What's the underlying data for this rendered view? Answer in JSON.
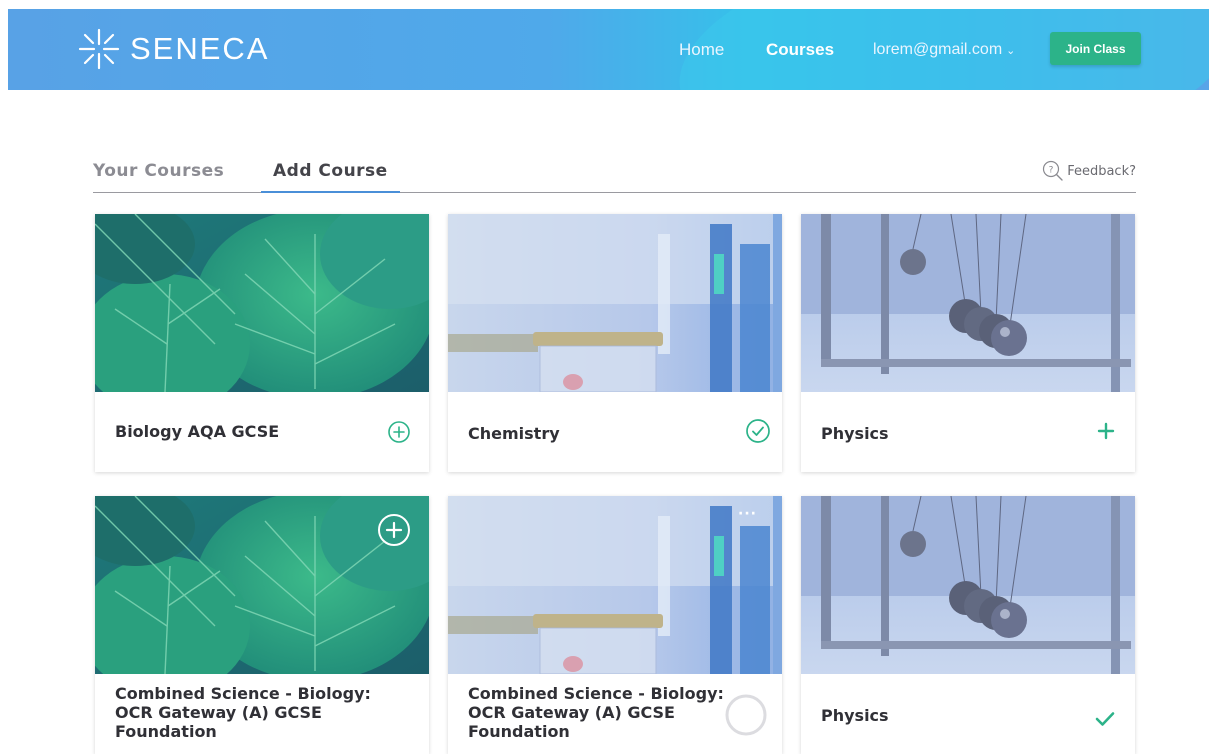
{
  "app": {
    "logo_text": "SENECA",
    "colors": {
      "accent": "#2cb389",
      "header": "#4fa9ea",
      "tab_underline": "#4a8fd8"
    }
  },
  "nav": {
    "home": "Home",
    "courses": "Courses",
    "account": "lorem@gmail.com",
    "account_chevron": "⌄",
    "join_class": "Join Class"
  },
  "tabs": {
    "your_courses": "Your Courses",
    "add_course": "Add Course",
    "feedback": "Feedback?"
  },
  "courses": [
    {
      "title": "Biology AQA GCSE",
      "image": "leaves-image",
      "status": "add-circle-icon"
    },
    {
      "title": "Chemistry",
      "image": "lab-jar-image",
      "status": "check-circle-icon"
    },
    {
      "title": "Physics",
      "image": "newtons-cradle-image",
      "status": "plus-icon"
    },
    {
      "title": "Combined Science - Biology: OCR Gateway (A) GCSE Foundation",
      "image": "leaves-image",
      "status": "add-circle-icon"
    },
    {
      "title": "Combined Science - Biology: OCR Gateway (A) GCSE Foundation",
      "image": "lab-jar-image",
      "status": "loading-spinner-icon",
      "menu": "···"
    },
    {
      "title": "Physics",
      "image": "newtons-cradle-image",
      "status": "check-icon"
    }
  ]
}
